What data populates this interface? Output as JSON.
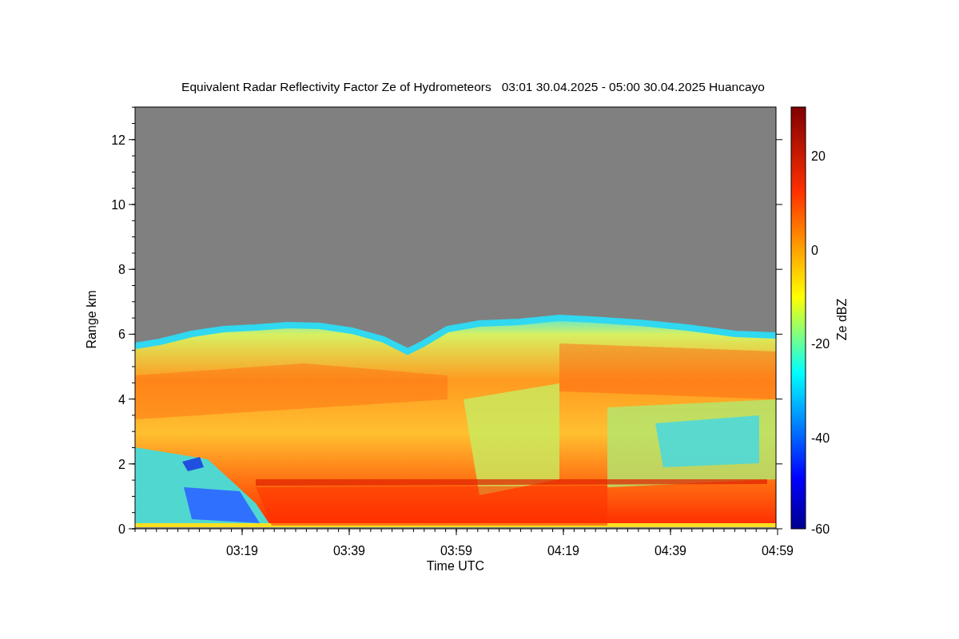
{
  "chart": {
    "title": "Equivalent Radar Reflectivity Factor Ze of Hydrometeors   03:01 30.04.2025 - 05:00 30.04.2025 Huancayo",
    "xlabel": "Time UTC",
    "ylabel": "Range km",
    "xticks": [
      "03:19",
      "03:39",
      "03:59",
      "04:19",
      "04:39",
      "04:59"
    ],
    "yticks": [
      "12",
      "10",
      "8",
      "6",
      "4",
      "2",
      "0"
    ]
  },
  "colorbar": {
    "label": "Ze dBZ",
    "ticks": [
      "20",
      "0",
      "-20",
      "-40",
      "-60"
    ]
  }
}
